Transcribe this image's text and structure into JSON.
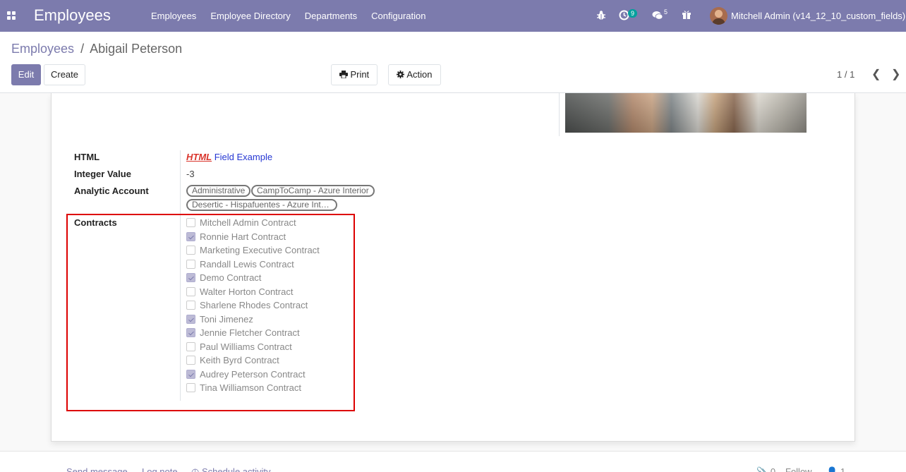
{
  "navbar": {
    "brand": "Employees",
    "menu": [
      "Employees",
      "Employee Directory",
      "Departments",
      "Configuration"
    ],
    "activity_count": "9",
    "message_count": "5",
    "user": "Mitchell Admin (v14_12_10_custom_fields)"
  },
  "breadcrumb": {
    "parent": "Employees",
    "separator": "/",
    "current": "Abigail Peterson"
  },
  "toolbar": {
    "edit_label": "Edit",
    "create_label": "Create",
    "print_label": "Print",
    "action_label": "Action",
    "pager": "1 / 1"
  },
  "form": {
    "html_label": "HTML",
    "html_value_emph": "HTML",
    "html_value_rest": " Field Example",
    "integer_label": "Integer Value",
    "integer_value": "-3",
    "analytic_label": "Analytic Account",
    "analytic_tags": [
      "Administrative",
      "CampToCamp - Azure Interior",
      "Desertic - Hispafuentes - Azure Int…"
    ],
    "contracts_label": "Contracts",
    "contracts": [
      {
        "label": "Mitchell Admin Contract",
        "checked": false
      },
      {
        "label": "Ronnie Hart Contract",
        "checked": true
      },
      {
        "label": "Marketing Executive Contract",
        "checked": false
      },
      {
        "label": "Randall Lewis Contract",
        "checked": false
      },
      {
        "label": "Demo Contract",
        "checked": true
      },
      {
        "label": "Walter Horton Contract",
        "checked": false
      },
      {
        "label": "Sharlene Rhodes Contract",
        "checked": false
      },
      {
        "label": "Toni Jimenez",
        "checked": true
      },
      {
        "label": "Jennie Fletcher Contract",
        "checked": true
      },
      {
        "label": "Paul Williams Contract",
        "checked": false
      },
      {
        "label": "Keith Byrd Contract",
        "checked": false
      },
      {
        "label": "Audrey Peterson Contract",
        "checked": true
      },
      {
        "label": "Tina Williamson Contract",
        "checked": false
      }
    ]
  },
  "chatter": {
    "send_message": "Send message",
    "log_note": "Log note",
    "schedule_activity": "Schedule activity",
    "attachments_count": "0",
    "follow": "Follow",
    "followers_count": "1"
  },
  "colors": {
    "brand": "#7c7bad",
    "highlight": "#dd0000"
  }
}
